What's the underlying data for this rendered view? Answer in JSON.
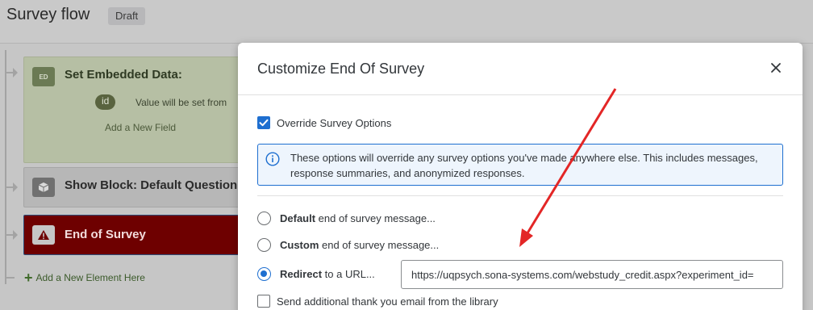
{
  "header": {
    "title": "Survey flow",
    "status_badge": "Draft"
  },
  "flow": {
    "embedded_data": {
      "icon_text": "ED",
      "title": "Set Embedded Data:",
      "field_name": "id",
      "field_value": "Value will be set from",
      "add_field": "Add a New Field"
    },
    "show_block": {
      "title": "Show Block: Default Question"
    },
    "end_of_survey": {
      "title": "End of Survey"
    },
    "add_element": "Add a New Element Here"
  },
  "modal": {
    "title": "Customize End Of Survey",
    "override_label": "Override Survey Options",
    "override_checked": true,
    "info_text": "These options will override any survey options you've made anywhere else. This includes messages, response summaries, and anonymized responses.",
    "options": [
      {
        "bold": "Default",
        "rest": " end of survey message...",
        "selected": false
      },
      {
        "bold": "Custom",
        "rest": " end of survey message...",
        "selected": false
      },
      {
        "bold": "Redirect",
        "rest": " to a URL...",
        "selected": true
      }
    ],
    "redirect_url": "https://uqpsych.sona-systems.com/webstudy_credit.aspx?experiment_id=",
    "thank_you_label": "Send additional thank you email from the library",
    "thank_you_checked": false
  },
  "colors": {
    "accent": "#1e6fd0",
    "end_of_survey_bg": "#6e0000",
    "annotation_arrow": "#e32626"
  }
}
